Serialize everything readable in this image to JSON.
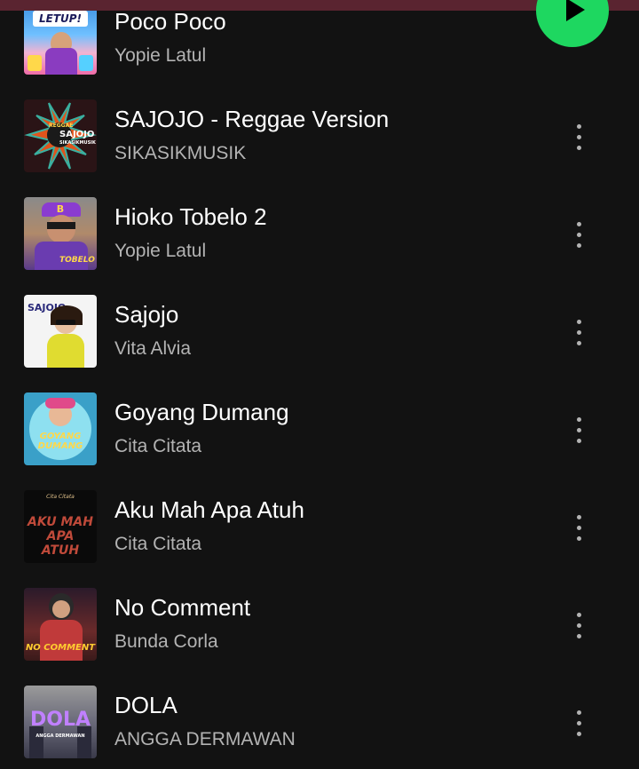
{
  "colors": {
    "background": "#121212",
    "accent": "#1ed760",
    "title": "#ffffff",
    "subtitle": "#b3b3b3",
    "header_strip": "#5a2430"
  },
  "play_button": {
    "icon": "play-icon"
  },
  "cover_labels": {
    "poco_poco": "LETUP!",
    "sajojo_reggae_top": "REGGAE",
    "sajojo_reggae_main": "SAJOJO",
    "sajojo_reggae_sub": "SIKASIKMUSIK",
    "hioko_badge": "B",
    "hioko": "TOBELO",
    "sajojo": "SAJOJO",
    "goyang": "GOYANG DUMANG",
    "aku_small": "Cita Citata",
    "aku": "AKU MAH APA ATUH",
    "no_comment": "NO COMMENT",
    "dola": "DOLA",
    "dola_sub": "ANGGA DERMAWAN"
  },
  "tracks": [
    {
      "title": "Poco Poco",
      "artist": "Yopie Latul"
    },
    {
      "title": "SAJOJO - Reggae Version",
      "artist": "SIKASIKMUSIK"
    },
    {
      "title": "Hioko Tobelo 2",
      "artist": "Yopie Latul"
    },
    {
      "title": "Sajojo",
      "artist": "Vita Alvia"
    },
    {
      "title": "Goyang Dumang",
      "artist": "Cita Citata"
    },
    {
      "title": "Aku Mah Apa Atuh",
      "artist": "Cita Citata"
    },
    {
      "title": "No Comment",
      "artist": "Bunda Corla"
    },
    {
      "title": "DOLA",
      "artist": "ANGGA DERMAWAN"
    }
  ]
}
